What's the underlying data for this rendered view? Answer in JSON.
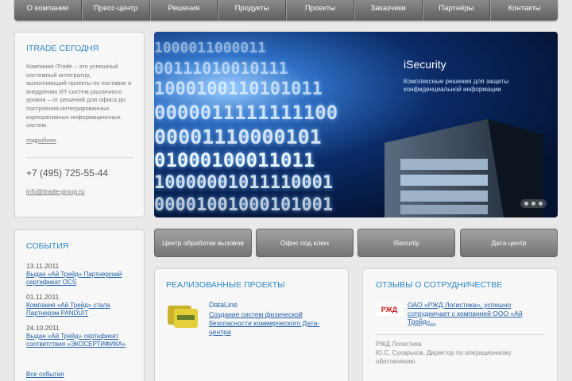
{
  "nav": {
    "items": [
      "О компании",
      "Пресс-центр",
      "Решения",
      "Продукты",
      "Проекты",
      "Заказчики",
      "Партнёры",
      "Контакты"
    ]
  },
  "about": {
    "title": "ITRADE СЕГОДНЯ",
    "text": "Компания iTrade – это успешный системный интегратор, выполняющий проекты по поставке и внедрению ИТ-систем различного уровня – от решений для офиса до построения интегрированных корпоративных информационных систем.",
    "more": "подробнее",
    "phone": "+7 (495) 725-55-44",
    "email": "info@itrade-group.ru"
  },
  "hero": {
    "title": "iSecurity",
    "subtitle": "Комплексные решения для защиты конфиденциальной информации",
    "dots": [
      "1",
      "2",
      "3"
    ]
  },
  "events": {
    "title": "СОБЫТИЯ",
    "items": [
      {
        "date": "13.11.2011",
        "text": "Выдан «Ай Трейд» Партнерский сертификат OCS"
      },
      {
        "date": "01.11.2011",
        "text": "Компания «Ай Трейд» стала Партнером PANDUIT"
      },
      {
        "date": "24.10.2011",
        "text": "Выдан «Ай Трейд» сертификат соответствия «ЭКОСЕРТИФИКА»"
      }
    ],
    "all": "Все события"
  },
  "buttons": [
    "Центр обработки вызовов",
    "Офис под ключ",
    "iSecurity",
    "Дата центр"
  ],
  "projects": {
    "title": "РЕАЛИЗОВАННЫЕ ПРОЕКТЫ",
    "item": {
      "name": "DataLine",
      "desc": "Создание систем физической безопасности коммерческого Дата-центра"
    }
  },
  "reviews": {
    "title": "ОТЗЫВЫ О СОТРУДНИЧЕСТВЕ",
    "logo_text": "РЖД",
    "text": "ОАО «РЖД Логистика», успешно сотрудничает с компанией ООО «Ай Трейд»...",
    "company": "РЖД Логистика",
    "author": "Ю.С. Сухарьков, Директор по операционному обеспечению"
  },
  "colors": {
    "accent": "#2e87c8",
    "link": "#1f5fa8",
    "nav": "#6e6e6e"
  }
}
